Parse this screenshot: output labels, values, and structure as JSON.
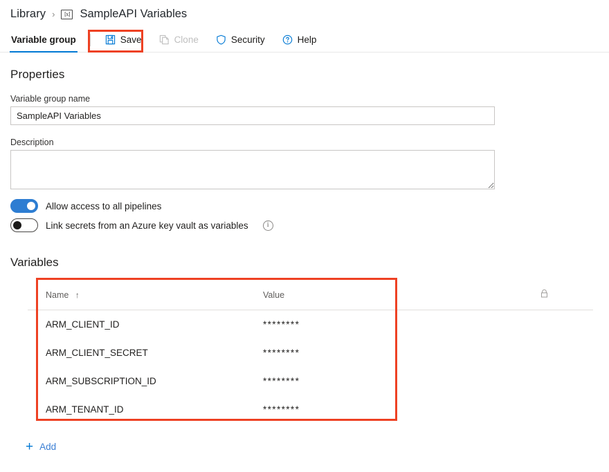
{
  "breadcrumb": {
    "root": "Library",
    "separator": "›",
    "icon_text": "[x]",
    "current": "SampleAPI Variables"
  },
  "toolbar": {
    "tab_label": "Variable group",
    "save_label": "Save",
    "clone_label": "Clone",
    "security_label": "Security",
    "help_label": "Help"
  },
  "properties": {
    "heading": "Properties",
    "name_label": "Variable group name",
    "name_value": "SampleAPI Variables",
    "description_label": "Description",
    "description_value": "",
    "toggles": [
      {
        "label": "Allow access to all pipelines",
        "state": "on"
      },
      {
        "label": "Link secrets from an Azure key vault as variables",
        "state": "off"
      }
    ]
  },
  "variables": {
    "heading": "Variables",
    "columns": {
      "name": "Name",
      "sort_indicator": "↑",
      "value": "Value",
      "lock": "lock-icon"
    },
    "rows": [
      {
        "name": "ARM_CLIENT_ID",
        "value": "********"
      },
      {
        "name": "ARM_CLIENT_SECRET",
        "value": "********"
      },
      {
        "name": "ARM_SUBSCRIPTION_ID",
        "value": "********"
      },
      {
        "name": "ARM_TENANT_ID",
        "value": "********"
      }
    ],
    "add_plus": "+",
    "add_label": "Add"
  },
  "colors": {
    "accent": "#0078d4",
    "annotation": "#ee4123",
    "toggle_on": "#2d7dd2"
  }
}
